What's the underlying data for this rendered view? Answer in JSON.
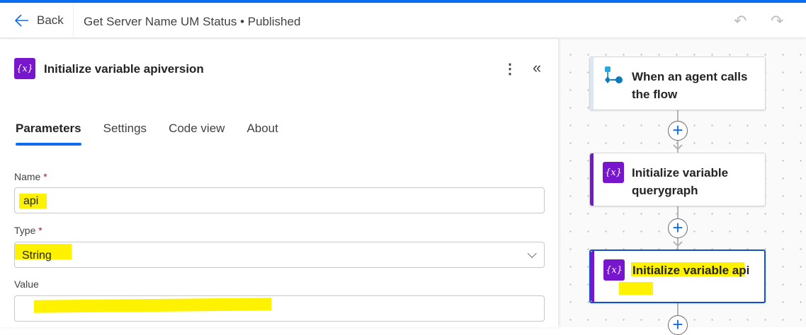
{
  "header": {
    "back_label": "Back",
    "title": "Get Server Name UM Status • Published"
  },
  "panel": {
    "title": "Initialize variable apiversion",
    "tabs": [
      {
        "label": "Parameters",
        "active": true
      },
      {
        "label": "Settings"
      },
      {
        "label": "Code view"
      },
      {
        "label": "About"
      }
    ],
    "fields": {
      "name": {
        "label": "Name",
        "required": "*",
        "value": "api"
      },
      "type": {
        "label": "Type",
        "required": "*",
        "value": "String"
      },
      "value": {
        "label": "Value",
        "required": "",
        "value": ""
      }
    }
  },
  "canvas": {
    "cards": [
      {
        "title": "When an agent calls the flow",
        "icon": "agent-trigger-icon"
      },
      {
        "title": "Initialize variable querygraph",
        "icon": "variable-icon"
      },
      {
        "title": "Initialize variable api",
        "icon": "variable-icon",
        "selected": true
      }
    ]
  },
  "colors": {
    "accent": "#0f6cf0",
    "variable": "#7716cc",
    "highlight": "#fff200",
    "selected_border": "#1250c4"
  }
}
